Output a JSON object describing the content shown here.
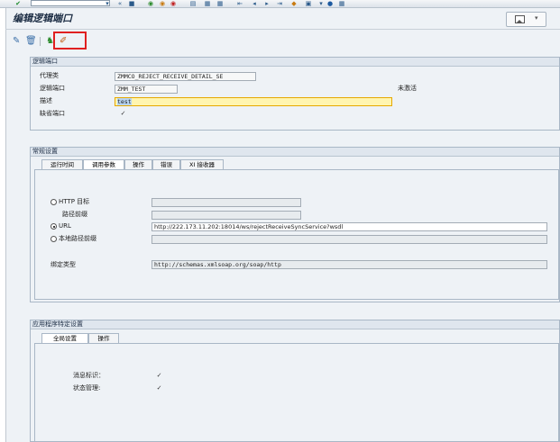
{
  "window": {
    "title": "编辑逻辑端口"
  },
  "logical_port": {
    "header": "逻辑端口",
    "proxy_class_label": "代理类",
    "proxy_class_value": "ZMMCO_REJECT_RECEIVE_DETAIL_SE",
    "logical_port_label": "逻辑端口",
    "logical_port_value": "ZMM_TEST",
    "status": "未激活",
    "description_label": "描述",
    "description_value": "test",
    "default_port_label": "缺省端口",
    "default_port_checked": true
  },
  "general": {
    "header": "常规设置",
    "tabs": [
      "运行时间",
      "调用参数",
      "操作",
      "错误",
      "XI 接收器"
    ],
    "active_tab": 1,
    "http_dest_label": "HTTP 目标",
    "path_prefix_label": "路径前缀",
    "url_label": "URL",
    "url_value": "http://222.173.11.202:18014/ws/rejectReceiveSyncService?wsdl",
    "local_path_label": "本地路径前缀",
    "binding_label": "绑定类型",
    "binding_value": "http://schemas.xmlsoap.org/soap/http"
  },
  "app_specific": {
    "header": "应用程序特定设置",
    "tabs": [
      "全局设置",
      "操作"
    ],
    "active_tab": 0,
    "msg_id_label": "消息标识：",
    "msg_id_checked": true,
    "state_label": "状态管理:",
    "state_checked": true
  },
  "icons": [
    "check-icon",
    "save-icon",
    "back-icon",
    "exit-icon",
    "cancel-icon",
    "print-icon",
    "find-icon",
    "help-icon",
    "display-icon",
    "delete-icon",
    "activate-icon",
    "edit-icon",
    "layout-icon"
  ],
  "colors": {
    "highlight": "#e02020",
    "description_bg": "#fff5b0"
  }
}
